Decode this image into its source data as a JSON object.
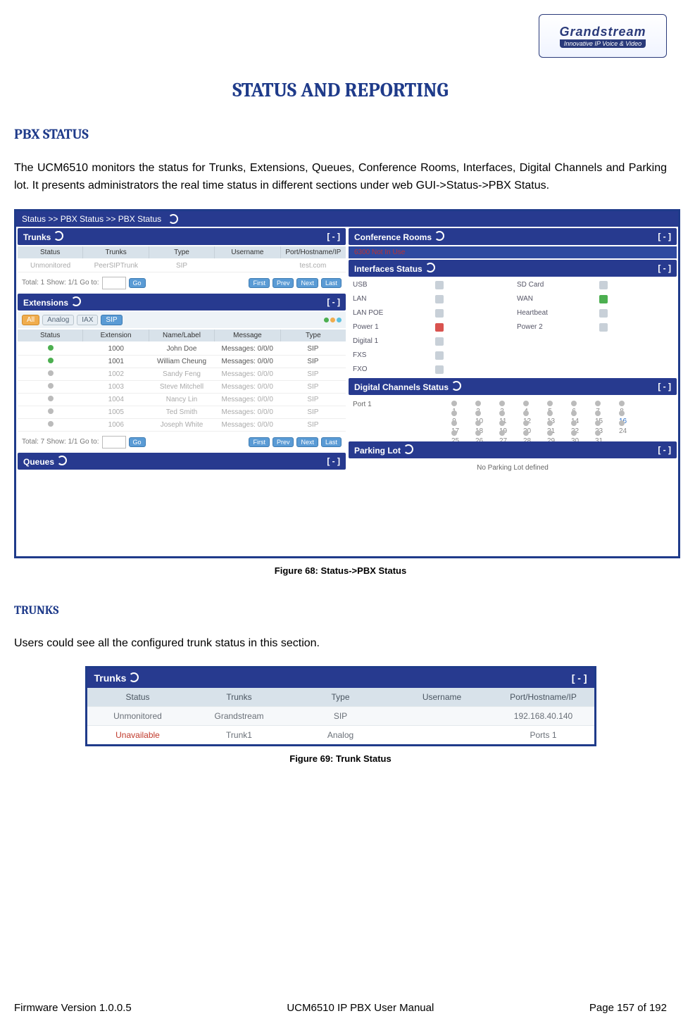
{
  "logo": {
    "brand": "Grandstream",
    "tag": "Innovative IP Voice & Video"
  },
  "title": "STATUS AND REPORTING",
  "section_pbx": "PBX STATUS",
  "para_pbx": "The UCM6510 monitors the status for Trunks, Extensions, Queues, Conference Rooms, Interfaces, Digital Channels and Parking lot. It presents administrators the real time status in different sections under web GUI->Status->PBX Status.",
  "fig68_caption": "Figure 68: Status->PBX Status",
  "section_trunks": "TRUNKS",
  "para_trunks": "Users could see all the configured trunk status in this section.",
  "fig69_caption": "Figure 69: Trunk Status",
  "footer": {
    "left": "Firmware Version 1.0.0.5",
    "center": "UCM6510 IP PBX User Manual",
    "right": "Page 157 of 192"
  },
  "shot1": {
    "crumb": "Status >> PBX Status >> PBX Status",
    "minus": "[ - ]",
    "trunks": {
      "title": "Trunks",
      "cols": [
        "Status",
        "Trunks",
        "Type",
        "Username",
        "Port/Hostname/IP"
      ],
      "row": [
        "Unmonitored",
        "PeerSIPTrunk",
        "SIP",
        "",
        "test.com"
      ],
      "pager_text": "Total: 1   Show: 1/1   Go to:",
      "go": "Go",
      "nav": [
        "First",
        "Prev",
        "Next",
        "Last"
      ]
    },
    "ext": {
      "title": "Extensions",
      "filters": [
        "All",
        "Analog",
        "IAX",
        "SIP"
      ],
      "cols": [
        "Status",
        "Extension",
        "Name/Label",
        "Message",
        "Type"
      ],
      "rows": [
        [
          "g",
          "1000",
          "John Doe",
          "Messages: 0/0/0",
          "SIP"
        ],
        [
          "g",
          "1001",
          "William Cheung",
          "Messages: 0/0/0",
          "SIP"
        ],
        [
          "gray",
          "1002",
          "Sandy Feng",
          "Messages: 0/0/0",
          "SIP"
        ],
        [
          "gray",
          "1003",
          "Steve Mitchell",
          "Messages: 0/0/0",
          "SIP"
        ],
        [
          "gray",
          "1004",
          "Nancy Lin",
          "Messages: 0/0/0",
          "SIP"
        ],
        [
          "gray",
          "1005",
          "Ted Smith",
          "Messages: 0/0/0",
          "SIP"
        ],
        [
          "gray",
          "1006",
          "Joseph White",
          "Messages: 0/0/0",
          "SIP"
        ]
      ],
      "pager_text": "Total: 7   Show: 1/1   Go to:"
    },
    "queues": {
      "title": "Queues"
    },
    "conf": {
      "title": "Conference Rooms",
      "line": "6300  Not In Use"
    },
    "ifaces": {
      "title": "Interfaces Status",
      "items": [
        [
          "USB",
          ""
        ],
        [
          "SD Card",
          ""
        ],
        [
          "LAN",
          ""
        ],
        [
          "WAN",
          "green"
        ],
        [
          "LAN POE",
          ""
        ],
        [
          "Heartbeat",
          ""
        ],
        [
          "Power 1",
          "red"
        ],
        [
          "Power 2",
          ""
        ],
        [
          "Digital 1",
          ""
        ],
        [
          "",
          ""
        ],
        [
          "FXS",
          ""
        ],
        [
          "",
          ""
        ],
        [
          "FXO",
          ""
        ],
        [
          "",
          ""
        ]
      ]
    },
    "digi": {
      "title": "Digital Channels Status",
      "port": "Port 1"
    },
    "park": {
      "title": "Parking Lot",
      "empty": "No Parking Lot defined"
    }
  },
  "shot2": {
    "title": "Trunks",
    "minus": "[ - ]",
    "cols": [
      "Status",
      "Trunks",
      "Type",
      "Username",
      "Port/Hostname/IP"
    ],
    "rows": [
      [
        "Unmonitored",
        "Grandstream",
        "SIP",
        "",
        "192.168.40.140"
      ],
      [
        "Unavailable",
        "Trunk1",
        "Analog",
        "",
        "Ports 1"
      ]
    ]
  },
  "bold": {
    "status": "Status",
    "pbx": "PBX Status"
  }
}
